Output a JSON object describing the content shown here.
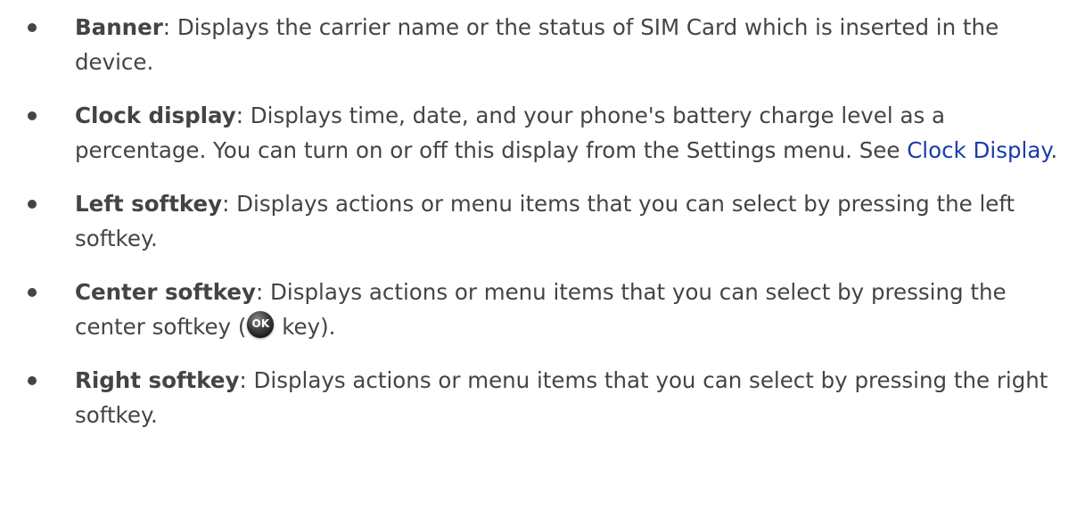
{
  "items": [
    {
      "term": "Banner",
      "text": ": Displays the carrier name or the status of SIM Card which is inserted in the device."
    },
    {
      "term": "Clock display",
      "text": ": Displays time, date, and your phone's battery charge level as a percentage. You can turn on or off this display from the Settings menu. See ",
      "link": "Clock Display",
      "after": "."
    },
    {
      "term": "Left softkey",
      "text": ": Displays actions or menu items that you can select by pressing the left softkey."
    },
    {
      "term": "Center softkey",
      "text": ": Displays actions or menu items that you can select by pressing the center softkey (",
      "icon_label": "OK",
      "after": " key)."
    },
    {
      "term": "Right softkey",
      "text": ": Displays actions or menu items that you can select by pressing the right softkey."
    }
  ],
  "icons": {
    "ok_key": "ok-key-icon"
  }
}
